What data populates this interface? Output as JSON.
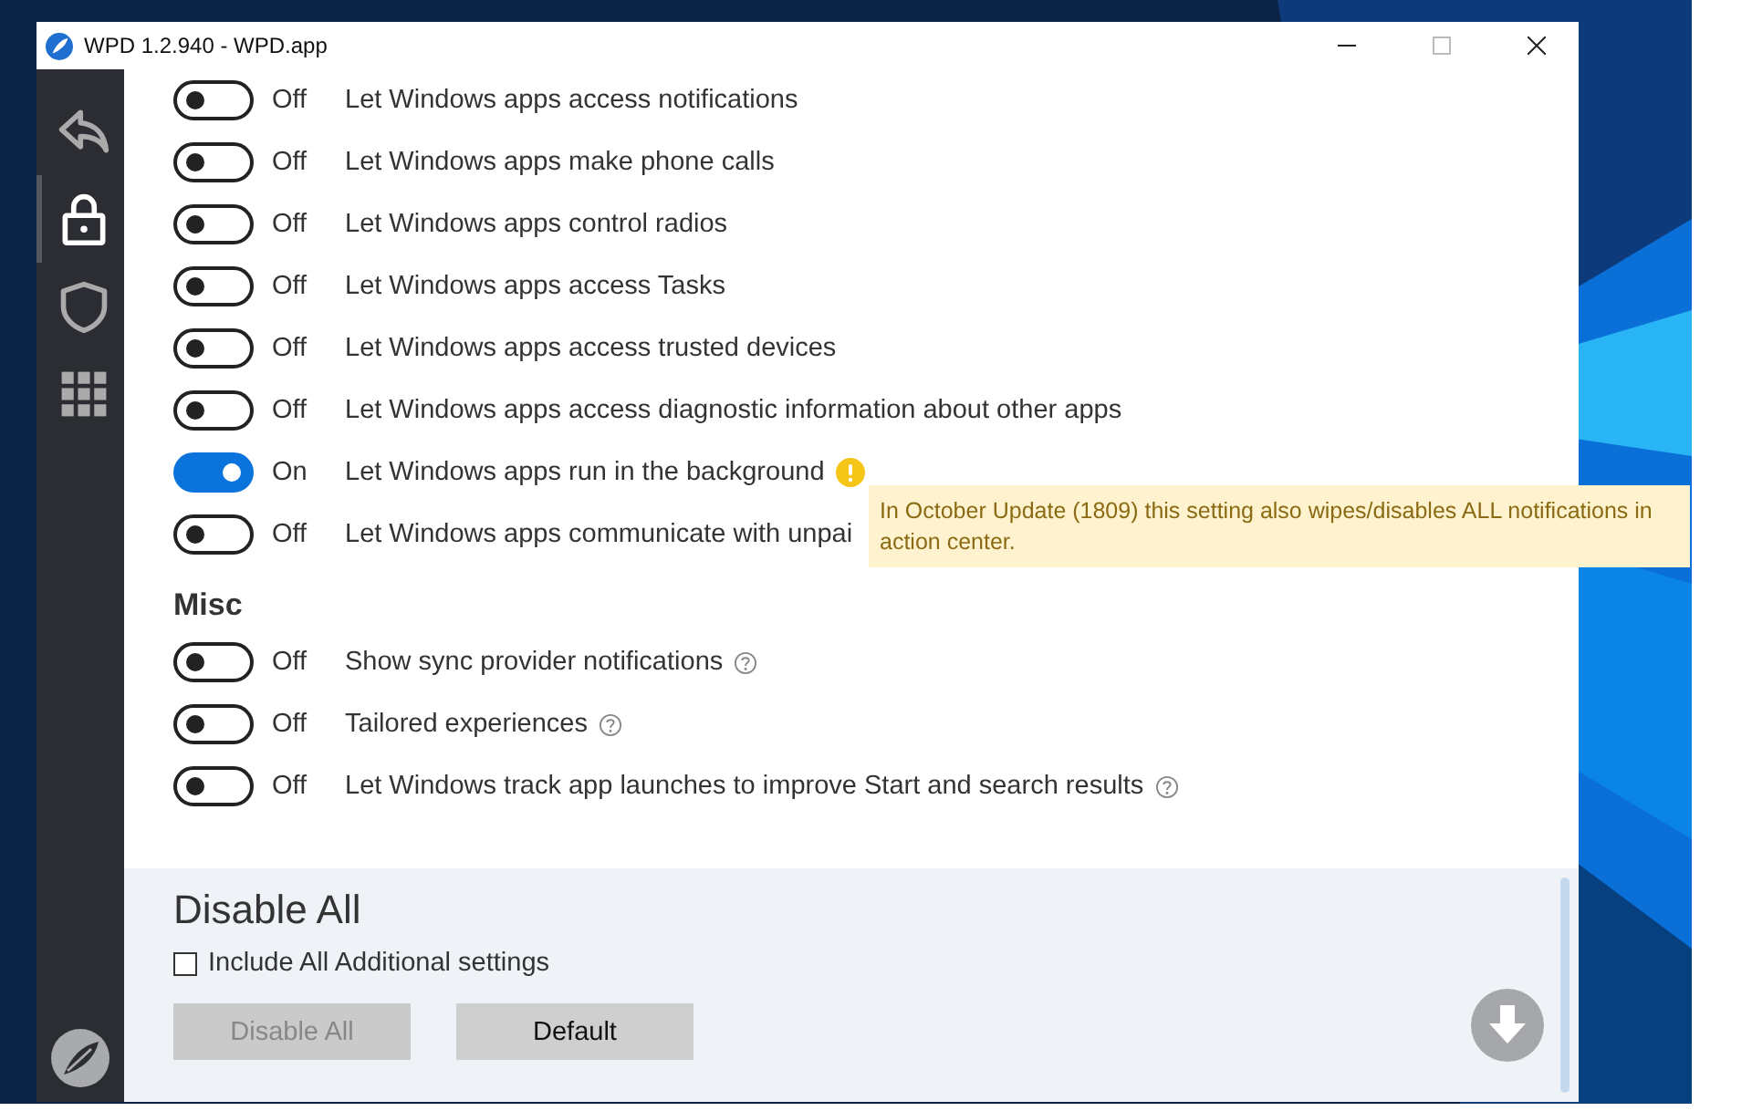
{
  "window": {
    "title": "WPD 1.2.940 - WPD.app"
  },
  "sidebar": {
    "items": [
      {
        "kind": "back",
        "selected": false
      },
      {
        "kind": "lock",
        "selected": true
      },
      {
        "kind": "shield",
        "selected": false
      },
      {
        "kind": "grid",
        "selected": false
      }
    ]
  },
  "sections": [
    {
      "rows": [
        {
          "on": false,
          "state": "Off",
          "label": "Let Windows apps access notifications"
        },
        {
          "on": false,
          "state": "Off",
          "label": "Let Windows apps make phone calls"
        },
        {
          "on": false,
          "state": "Off",
          "label": "Let Windows apps control radios"
        },
        {
          "on": false,
          "state": "Off",
          "label": "Let Windows apps access Tasks"
        },
        {
          "on": false,
          "state": "Off",
          "label": "Let Windows apps access trusted devices"
        },
        {
          "on": false,
          "state": "Off",
          "label": "Let Windows apps access diagnostic information about other apps"
        },
        {
          "on": true,
          "state": "On",
          "label": "Let Windows apps run in the background",
          "warning": true
        },
        {
          "on": false,
          "state": "Off",
          "label": "Let Windows apps communicate with unpai"
        }
      ]
    },
    {
      "title": "Misc",
      "rows": [
        {
          "on": false,
          "state": "Off",
          "label": "Show sync provider notifications",
          "help": true
        },
        {
          "on": false,
          "state": "Off",
          "label": "Tailored experiences",
          "help": true
        },
        {
          "on": false,
          "state": "Off",
          "label": "Let Windows track app launches to improve Start and search results",
          "help": true
        }
      ]
    }
  ],
  "tooltip": {
    "text": "In October Update (1809) this setting also wipes/disables ALL notifications in action center."
  },
  "footer": {
    "title": "Disable All",
    "checkbox": {
      "label": "Include All Additional settings",
      "checked": false
    },
    "buttons": [
      {
        "label": "Disable All",
        "disabled": true
      },
      {
        "label": "Default",
        "disabled": false
      }
    ]
  }
}
